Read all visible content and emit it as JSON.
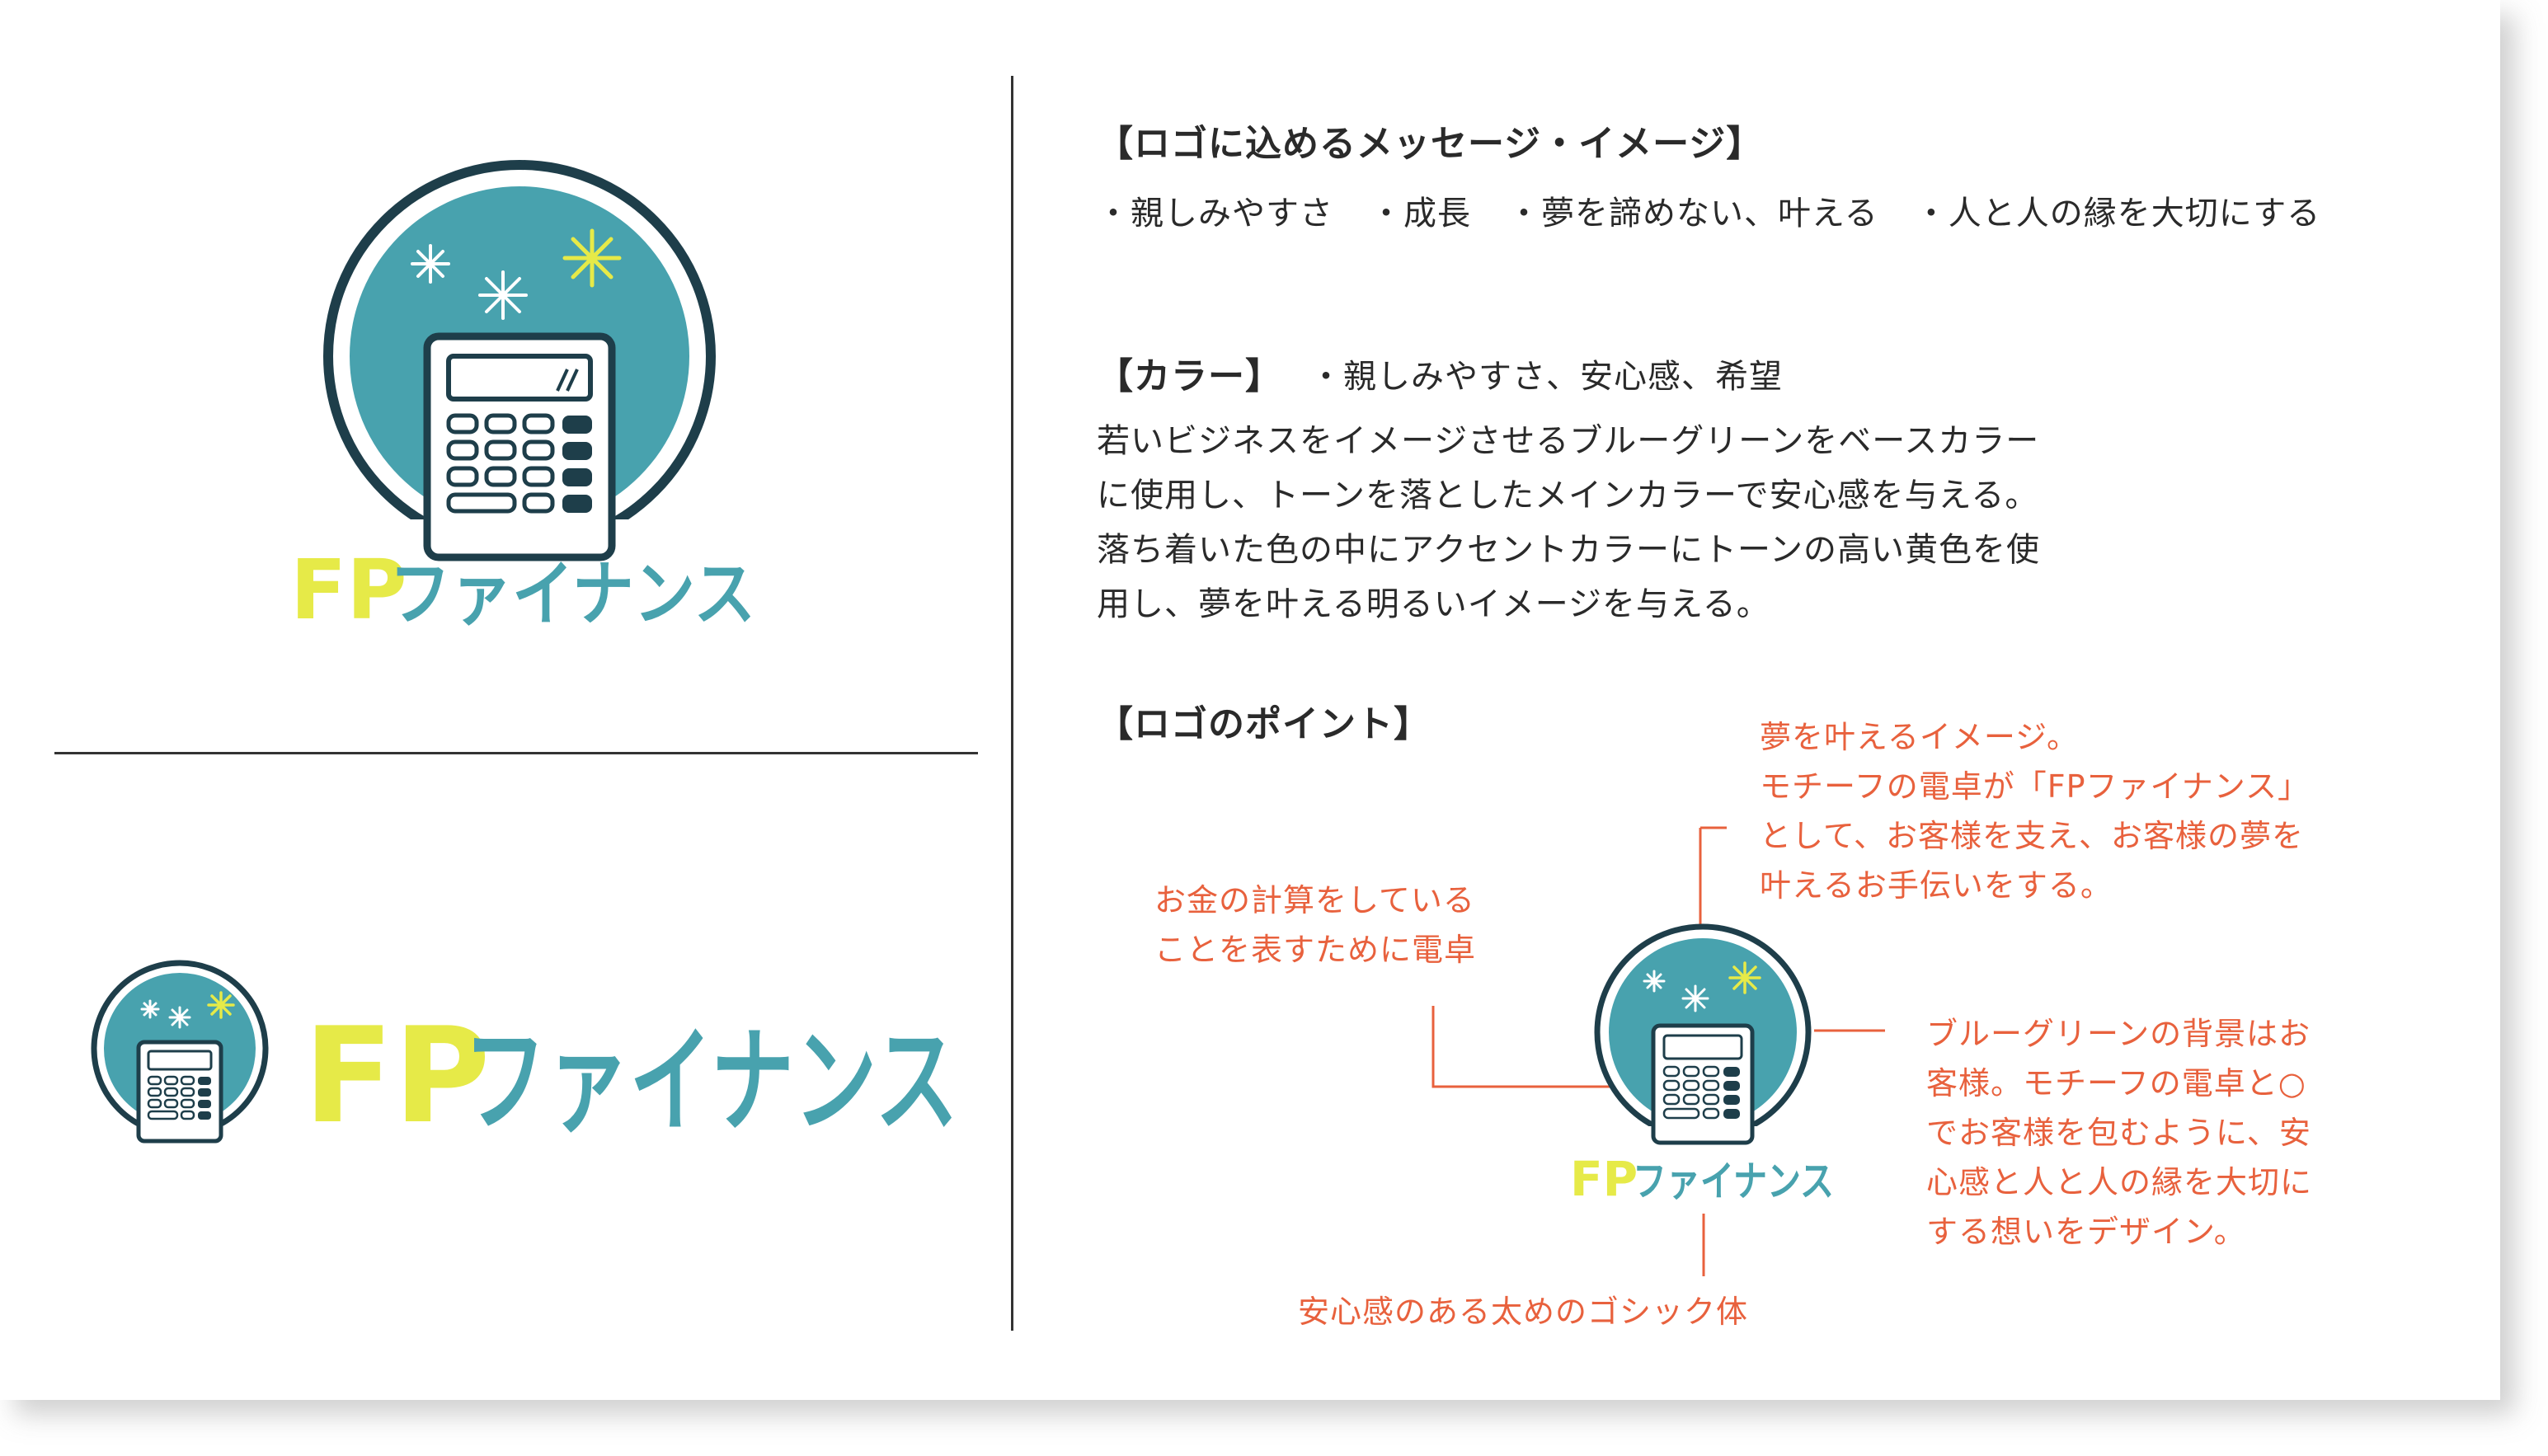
{
  "brand": {
    "fp": "FP",
    "katakana": "ファイナンス",
    "colors": {
      "teal": "#48a2ae",
      "navy": "#1e3e4a",
      "yellow": "#e6ea48",
      "accent_text": "#e8613d"
    }
  },
  "message": {
    "heading": "【ロゴに込めるメッセージ・イメージ】",
    "bullets": [
      "・親しみやすさ",
      "・成長",
      "・夢を諦めない、叶える",
      "・人と人の縁を大切にする"
    ]
  },
  "color_section": {
    "heading": "【カラー】",
    "keywords": "・親しみやすさ、安心感、希望",
    "paragraph": [
      "若いビジネスをイメージさせるブルーグリーンをベースカラー",
      "に使用し、トーンを落としたメインカラーで安心感を与える。",
      "落ち着いた色の中にアクセントカラーにトーンの高い黄色を使",
      "用し、夢を叶える明るいイメージを与える。"
    ]
  },
  "points": {
    "heading": "【ロゴのポイント】",
    "dream_note": [
      "夢を叶えるイメージ。",
      "モチーフの電卓が「FPファイナンス」",
      "として、お客様を支え、お客様の夢を",
      "叶えるお手伝いをする。"
    ],
    "calc_note": [
      "お金の計算をしている",
      "ことを表すために電卓"
    ],
    "bg_note": [
      "ブルーグリーンの背景はお",
      "客様。モチーフの電卓と○",
      "でお客様を包むように、安",
      "心感と人と人の縁を大切に",
      "する想いをデザイン。"
    ],
    "font_note": "安心感のある太めのゴシック体"
  }
}
